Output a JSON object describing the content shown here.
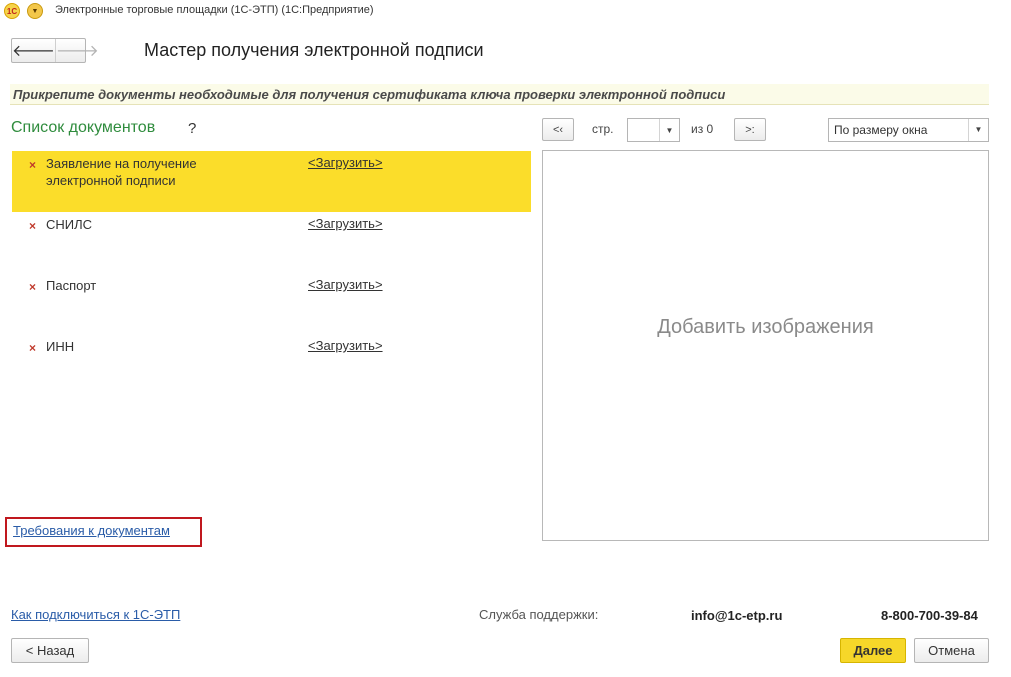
{
  "window": {
    "logo_text": "1С",
    "title": "Электронные торговые площадки (1С-ЭТП)   (1С:Предприятие)"
  },
  "nav": {
    "back_icon": "arrow-left-icon",
    "forward_icon": "arrow-right-icon"
  },
  "page": {
    "title": "Мастер получения электронной подписи",
    "hint": "Прикрепите документы необходимые для получения сертификата ключа проверки электронной подписи"
  },
  "documents": {
    "title": "Список документов",
    "help": "?",
    "items": [
      {
        "mark": "×",
        "name": "Заявление на получение электронной подписи",
        "action": "<Загрузить>",
        "selected": true
      },
      {
        "mark": "×",
        "name": "СНИЛС",
        "action": "<Загрузить>",
        "selected": false
      },
      {
        "mark": "×",
        "name": "Паспорт",
        "action": "<Загрузить>",
        "selected": false
      },
      {
        "mark": "×",
        "name": "ИНН",
        "action": "<Загрузить>",
        "selected": false
      }
    ],
    "requirements_link": "Требования к документам"
  },
  "viewer": {
    "prev_label": "<‹",
    "page_label": "стр.",
    "page_value": "",
    "of_label": "из 0",
    "next_label": ">:",
    "zoom_value": "По размеру окна",
    "placeholder": "Добавить изображения"
  },
  "footer": {
    "connect_link": "Как подключиться к 1С-ЭТП",
    "support_label": "Служба поддержки:",
    "support_email": "info@1c-etp.ru",
    "support_phone": "8-800-700-39-84",
    "back_button": "< Назад",
    "next_button": "Далее",
    "cancel_button": "Отмена"
  },
  "colors": {
    "accent_yellow": "#fbdd2a",
    "green_title": "#2f8c3d",
    "link_blue": "#2a5ca8",
    "highlight_red": "#c0181e"
  }
}
